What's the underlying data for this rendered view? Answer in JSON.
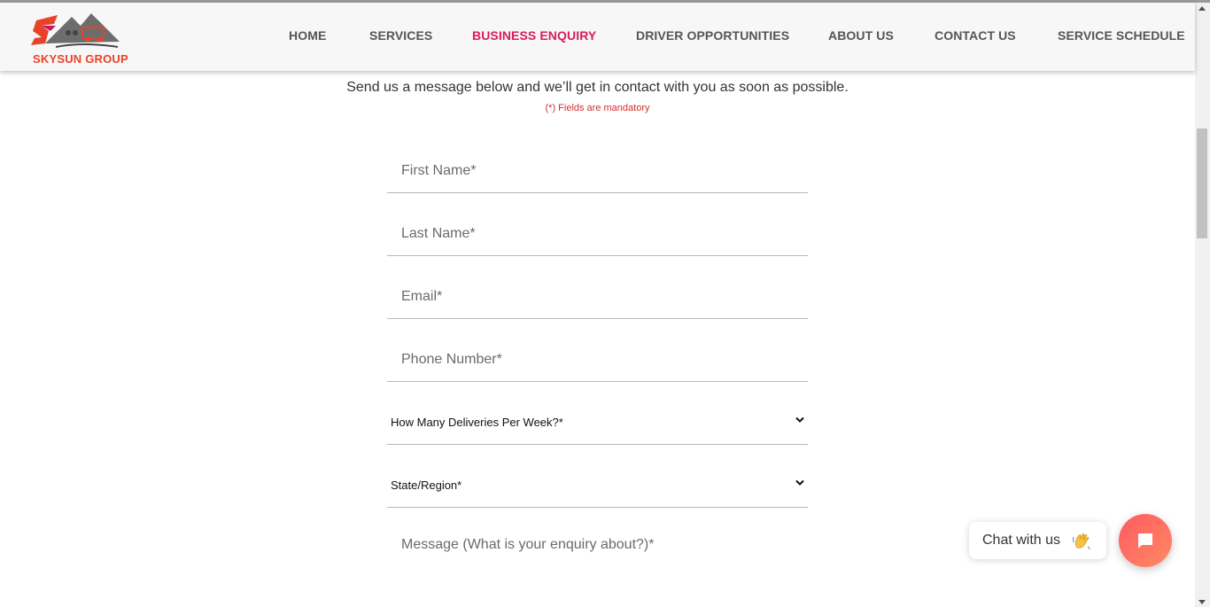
{
  "brand": {
    "name": "SKYSUN GROUP"
  },
  "nav": {
    "items": [
      {
        "label": "HOME"
      },
      {
        "label": "SERVICES"
      },
      {
        "label": "BUSINESS ENQUIRY"
      },
      {
        "label": "DRIVER OPPORTUNITIES"
      },
      {
        "label": "ABOUT US"
      },
      {
        "label": "CONTACT US"
      },
      {
        "label": "SERVICE SCHEDULE"
      }
    ],
    "active": "BUSINESS ENQUIRY"
  },
  "form": {
    "intro": "Send us a message below and we’ll get in contact with you as soon as possible.",
    "mandatory_note": "(*) Fields are mandatory",
    "first_name": {
      "placeholder": "First Name*",
      "value": ""
    },
    "last_name": {
      "placeholder": "Last Name*",
      "value": ""
    },
    "email": {
      "placeholder": "Email*",
      "value": ""
    },
    "phone": {
      "placeholder": "Phone Number*",
      "value": ""
    },
    "deliveries": {
      "selected": "How Many Deliveries Per Week?*"
    },
    "state": {
      "selected": "State/Region*"
    },
    "message": {
      "placeholder": "Message (What is your enquiry about?)*",
      "value": ""
    }
  },
  "chat": {
    "label": "Chat with us",
    "wave_icon": "waving-hand-icon",
    "launcher_icon": "chat-bubble-icon"
  },
  "colors": {
    "active_nav": "#d81b60",
    "brand_orange": "#e8432a",
    "mandatory": "#d32f2f",
    "chat_accent": "#ff5a5f"
  }
}
